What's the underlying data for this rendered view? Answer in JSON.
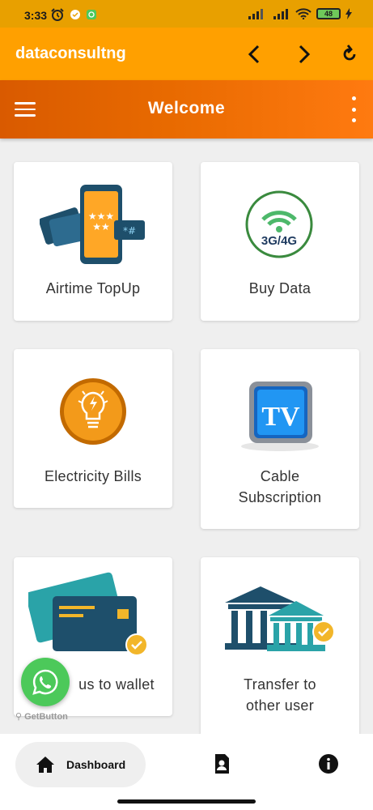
{
  "status": {
    "time": "3:33",
    "battery": "48"
  },
  "browser": {
    "title": "dataconsultng"
  },
  "header": {
    "title": "Welcome"
  },
  "cards": [
    {
      "label": "Airtime TopUp"
    },
    {
      "label": "Buy Data",
      "icon_text": "3G/4G"
    },
    {
      "label": "Electricity Bills"
    },
    {
      "label": "Cable Subscription",
      "icon_text": "TV"
    },
    {
      "label": "Bonus to wallet",
      "visible_label": "us to wallet"
    },
    {
      "label": "Transfer to other user"
    }
  ],
  "widget": {
    "brand": "GetButton"
  },
  "nav": {
    "dashboard_label": "Dashboard"
  },
  "colors": {
    "primary": "#ffa000",
    "header_start": "#d95a00",
    "header_end": "#ff7a10",
    "whatsapp": "#4cc95a"
  }
}
